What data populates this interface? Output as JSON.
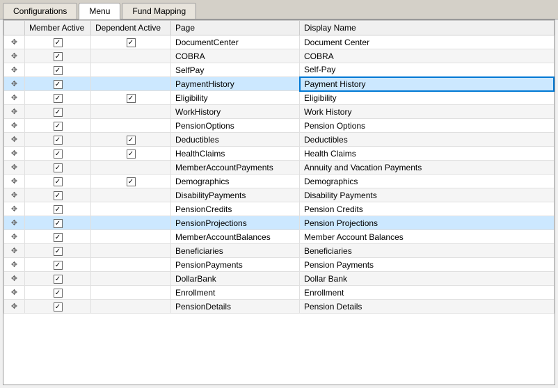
{
  "tabs": [
    {
      "label": "Configurations",
      "active": false
    },
    {
      "label": "Menu",
      "active": true
    },
    {
      "label": "Fund Mapping",
      "active": false
    }
  ],
  "table": {
    "columns": [
      "",
      "Member Active",
      "Dependent Active",
      "Page",
      "Display Name"
    ],
    "rows": [
      {
        "drag": true,
        "memberActive": true,
        "dependentActive": true,
        "page": "DocumentCenter",
        "displayName": "Document Center",
        "highlighted": false,
        "displayNameHighlighted": false
      },
      {
        "drag": true,
        "memberActive": true,
        "dependentActive": false,
        "page": "COBRA",
        "displayName": "COBRA",
        "highlighted": false,
        "displayNameHighlighted": false
      },
      {
        "drag": true,
        "memberActive": true,
        "dependentActive": false,
        "page": "SelfPay",
        "displayName": "Self-Pay",
        "highlighted": false,
        "displayNameHighlighted": false
      },
      {
        "drag": true,
        "memberActive": true,
        "dependentActive": false,
        "page": "PaymentHistory",
        "displayName": "Payment History",
        "highlighted": true,
        "displayNameHighlighted": true
      },
      {
        "drag": true,
        "memberActive": true,
        "dependentActive": true,
        "page": "Eligibility",
        "displayName": "Eligibility",
        "highlighted": false,
        "displayNameHighlighted": false
      },
      {
        "drag": true,
        "memberActive": true,
        "dependentActive": false,
        "page": "WorkHistory",
        "displayName": "Work History",
        "highlighted": false,
        "displayNameHighlighted": false
      },
      {
        "drag": true,
        "memberActive": true,
        "dependentActive": false,
        "page": "PensionOptions",
        "displayName": "Pension Options",
        "highlighted": false,
        "displayNameHighlighted": false
      },
      {
        "drag": true,
        "memberActive": true,
        "dependentActive": true,
        "page": "Deductibles",
        "displayName": "Deductibles",
        "highlighted": false,
        "displayNameHighlighted": false
      },
      {
        "drag": true,
        "memberActive": true,
        "dependentActive": true,
        "page": "HealthClaims",
        "displayName": "Health Claims",
        "highlighted": false,
        "displayNameHighlighted": false
      },
      {
        "drag": true,
        "memberActive": true,
        "dependentActive": false,
        "page": "MemberAccountPayments",
        "displayName": "Annuity and Vacation Payments",
        "highlighted": false,
        "displayNameHighlighted": false
      },
      {
        "drag": true,
        "memberActive": true,
        "dependentActive": true,
        "page": "Demographics",
        "displayName": "Demographics",
        "highlighted": false,
        "displayNameHighlighted": false
      },
      {
        "drag": true,
        "memberActive": true,
        "dependentActive": false,
        "page": "DisabilityPayments",
        "displayName": "Disability Payments",
        "highlighted": false,
        "displayNameHighlighted": false
      },
      {
        "drag": true,
        "memberActive": true,
        "dependentActive": false,
        "page": "PensionCredits",
        "displayName": "Pension Credits",
        "highlighted": false,
        "displayNameHighlighted": false
      },
      {
        "drag": true,
        "memberActive": true,
        "dependentActive": false,
        "page": "PensionProjections",
        "displayName": "Pension Projections",
        "highlighted": true,
        "displayNameHighlighted": false
      },
      {
        "drag": true,
        "memberActive": true,
        "dependentActive": false,
        "page": "MemberAccountBalances",
        "displayName": "Member Account Balances",
        "highlighted": false,
        "displayNameHighlighted": false
      },
      {
        "drag": true,
        "memberActive": true,
        "dependentActive": false,
        "page": "Beneficiaries",
        "displayName": "Beneficiaries",
        "highlighted": false,
        "displayNameHighlighted": false
      },
      {
        "drag": true,
        "memberActive": true,
        "dependentActive": false,
        "page": "PensionPayments",
        "displayName": "Pension Payments",
        "highlighted": false,
        "displayNameHighlighted": false
      },
      {
        "drag": true,
        "memberActive": true,
        "dependentActive": false,
        "page": "DollarBank",
        "displayName": "Dollar Bank",
        "highlighted": false,
        "displayNameHighlighted": false
      },
      {
        "drag": true,
        "memberActive": true,
        "dependentActive": false,
        "page": "Enrollment",
        "displayName": "Enrollment",
        "highlighted": false,
        "displayNameHighlighted": false
      },
      {
        "drag": true,
        "memberActive": true,
        "dependentActive": false,
        "page": "PensionDetails",
        "displayName": "Pension Details",
        "highlighted": false,
        "displayNameHighlighted": false
      }
    ]
  }
}
